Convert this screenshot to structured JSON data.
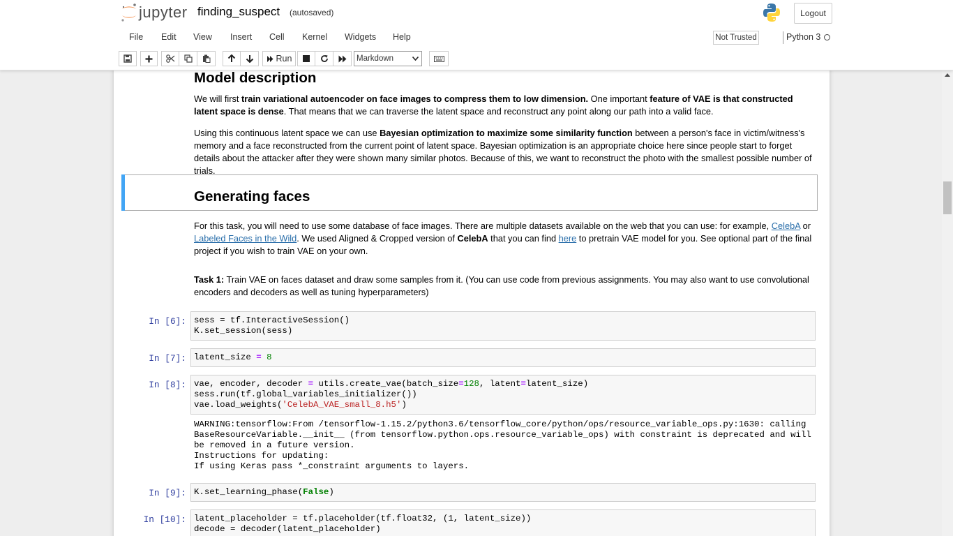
{
  "header": {
    "logo_text": "jupyter",
    "notebook_name": "finding_suspect",
    "autosave_status": "(autosaved)",
    "logout_label": "Logout"
  },
  "menu": [
    "File",
    "Edit",
    "View",
    "Insert",
    "Cell",
    "Kernel",
    "Widgets",
    "Help"
  ],
  "trust_label": "Not Trusted",
  "kernel_name": "Python 3",
  "toolbar": {
    "run_label": "Run",
    "cell_type": "Markdown"
  },
  "content": {
    "model_heading": "Model description",
    "p1": {
      "a": "We will first ",
      "b": "train variational autoencoder on face images to compress them to low dimension.",
      "c": " One important ",
      "d": "feature of VAE is that constructed latent space is dense",
      "e": ". That means that we can traverse the latent space and reconstruct any point along our path into a valid face."
    },
    "p2": {
      "a": "Using this continuous latent space we can use ",
      "b": "Bayesian optimization to maximize some similarity function",
      "c": " between a person's face in victim/witness's memory and a face reconstructed from the current point of latent space. Bayesian optimization is an appropriate choice here since people start to forget details about the attacker after they were shown many similar photos. Because of this, we want to reconstruct the photo with the smallest possible number of trials."
    },
    "gen_heading": "Generating faces",
    "p3": {
      "a": "For this task, you will need to use some database of face images. There are multiple datasets available on the web that you can use: for example, ",
      "link1": "CelebA",
      "b": " or ",
      "link2": "Labeled Faces in the Wild",
      "c": ". We used Aligned & Cropped version of ",
      "d": "CelebA",
      "e": " that you can find ",
      "link3": "here",
      "f": " to pretrain VAE model for you. See optional part of the final project if you wish to train VAE on your own."
    },
    "task": {
      "label": "Task 1:",
      "text": " Train VAE on faces dataset and draw some samples from it. (You can use code from previous assignments. You may also want to use convolutional encoders and decoders as well as tuning hyperparameters)"
    }
  },
  "cells": [
    {
      "prompt": "In [6]:",
      "lines": [
        "sess = tf.InteractiveSession()",
        "K.set_session(sess)"
      ]
    },
    {
      "prompt": "In [7]:",
      "lines": [
        "latent_size = 8"
      ]
    },
    {
      "prompt": "In [8]:",
      "lines": [
        "vae, encoder, decoder = utils.create_vae(batch_size=128, latent=latent_size)",
        "sess.run(tf.global_variables_initializer())",
        "vae.load_weights('CelebA_VAE_small_8.h5')"
      ],
      "output": "WARNING:tensorflow:From /tensorflow-1.15.2/python3.6/tensorflow_core/python/ops/resource_variable_ops.py:1630: calling BaseResourceVariable.__init__ (from tensorflow.python.ops.resource_variable_ops) with constraint is deprecated and will be removed in a future version.\nInstructions for updating:\nIf using Keras pass *_constraint arguments to layers."
    },
    {
      "prompt": "In [9]:",
      "lines": [
        "K.set_learning_phase(False)"
      ]
    },
    {
      "prompt": "In [10]:",
      "lines": [
        "latent_placeholder = tf.placeholder(tf.float32, (1, latent_size))",
        "decode = decoder(latent_placeholder)"
      ]
    }
  ],
  "colors": {
    "accent": "#42a5f5",
    "prompt": "#303f9f",
    "link": "#296eaa",
    "code_bg": "#f7f7f7",
    "string": "#ba2121",
    "number": "#008000",
    "operator": "#aa22ff"
  },
  "icons": [
    "jupyter-logo",
    "python-logo",
    "save-icon",
    "plus-icon",
    "cut-icon",
    "copy-icon",
    "paste-icon",
    "arrow-up-icon",
    "arrow-down-icon",
    "run-icon",
    "stop-icon",
    "restart-icon",
    "fast-forward-icon",
    "keyboard-icon",
    "kernel-idle-icon"
  ]
}
